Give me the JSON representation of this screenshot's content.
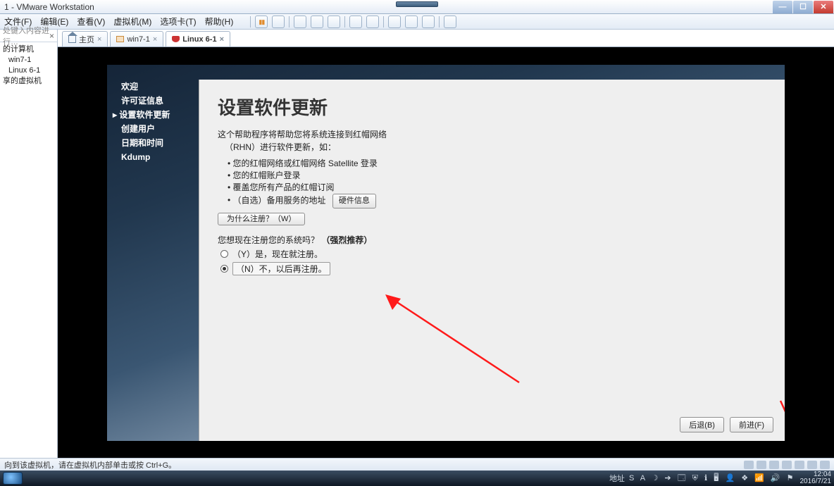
{
  "window": {
    "title": "1 - VMware Workstation"
  },
  "menu": {
    "file": "文件(F)",
    "edit": "编辑(E)",
    "view": "查看(V)",
    "vm": "虚拟机(M)",
    "tabs": "选项卡(T)",
    "help": "帮助(H)"
  },
  "sidebar": {
    "search_placeholder": "处键入内容进行…",
    "nodes": {
      "root": "的计算机",
      "vm1": "win7-1",
      "vm2": "Linux 6-1",
      "shared": "享的虚拟机"
    }
  },
  "tabs": {
    "home": "主页",
    "t1": "win7-1",
    "t2": "Linux 6-1"
  },
  "wizard": {
    "steps": {
      "s0": "欢迎",
      "s1": "许可证信息",
      "s2": "设置软件更新",
      "s3": "创建用户",
      "s4": "日期和时间",
      "s5": "Kdump"
    },
    "title": "设置软件更新",
    "intro1": "这个帮助程序将帮助您将系统连接到红帽网络",
    "intro2": "（RHN）进行软件更新，如：",
    "b1": "您的红帽网络或红帽网络 Satellite 登录",
    "b2": "您的红帽账户登录",
    "b3": "覆盖您所有产品的红帽订阅",
    "b4": "（自选）备用服务的地址",
    "hwinfo": "硬件信息",
    "whyreg": "为什么注册？（W）",
    "question_pre": "您想现在注册您的系统吗？",
    "question_strong": "（强烈推荐）",
    "opt_yes": "（Y）是，现在就注册。",
    "opt_no": "（N）不，以后再注册。",
    "back": "后退(B)",
    "forward": "前进(F)"
  },
  "statusbar": {
    "msg": "向到该虚拟机，请在虚拟机内部单击或按 Ctrl+G。"
  },
  "taskbar": {
    "addr_label": "地址",
    "time": "12:04",
    "date": "2016/7/21"
  }
}
